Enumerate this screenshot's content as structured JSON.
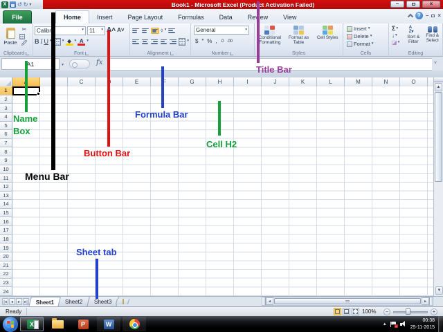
{
  "window": {
    "title": "Book1 - Microsoft Excel (Product Activation Failed)"
  },
  "quick_access": {
    "icons": [
      "excel-logo",
      "save",
      "undo",
      "redo",
      "customize-dropdown"
    ]
  },
  "tabs": {
    "file": "File",
    "active": "Home",
    "items": [
      "Home",
      "Insert",
      "Page Layout",
      "Formulas",
      "Data",
      "Review",
      "View"
    ]
  },
  "ribbon": {
    "clipboard": {
      "label": "Clipboard",
      "paste": "Paste"
    },
    "font": {
      "label": "Font",
      "name": "Calibri",
      "size": "11",
      "bold": "B",
      "italic": "I",
      "underline": "U"
    },
    "alignment": {
      "label": "Alignment"
    },
    "number": {
      "label": "Number",
      "format": "General",
      "currency": "$",
      "percent": "%",
      "comma": ",",
      "inc_decimal": ".0",
      "dec_decimal": ".00"
    },
    "styles": {
      "label": "Styles",
      "conditional": "Conditional Formatting",
      "format_table": "Format as Table",
      "cell_styles": "Cell Styles"
    },
    "cells": {
      "label": "Cells",
      "insert": "Insert",
      "delete": "Delete",
      "format": "Format"
    },
    "editing": {
      "label": "Editing",
      "autosum": "Σ",
      "sort_filter": "Sort & Filter",
      "find_select": "Find & Select"
    }
  },
  "formula_bar": {
    "name_box": "A1",
    "fx_label": "fx"
  },
  "grid": {
    "columns": [
      "A",
      "B",
      "C",
      "D",
      "E",
      "F",
      "G",
      "H",
      "I",
      "J",
      "K",
      "L",
      "M",
      "N",
      "O"
    ],
    "row_count": 24,
    "selected_cell": "A1",
    "selected_column": "A",
    "selected_row": 1
  },
  "sheet_tabs": {
    "active": "Sheet1",
    "items": [
      "Sheet1",
      "Sheet2",
      "Sheet3"
    ]
  },
  "status_bar": {
    "mode": "Ready",
    "zoom_level": "100%",
    "view_icons": [
      "normal-view",
      "page-layout-view",
      "page-break-view"
    ]
  },
  "taskbar": {
    "icons": [
      "windows-start",
      "excel",
      "file-explorer",
      "powerpoint",
      "word",
      "chrome"
    ],
    "tray_icons": [
      "hidden-icons",
      "action-center-flag",
      "volume"
    ],
    "clock": {
      "time": "00:38",
      "date": "25-11-2015"
    }
  },
  "annotations": [
    {
      "id": "title-bar",
      "label": "Title Bar",
      "color": "#993b99"
    },
    {
      "id": "menu-bar",
      "label": "Menu Bar",
      "color": "#000000"
    },
    {
      "id": "name-box",
      "label": "Name Box",
      "color": "#16a03a"
    },
    {
      "id": "button-bar",
      "label": "Button Bar",
      "color": "#e01212"
    },
    {
      "id": "formula-bar",
      "label": "Formula Bar",
      "color": "#2441c6"
    },
    {
      "id": "cell-h2",
      "label": "Cell H2",
      "color": "#16a03a"
    },
    {
      "id": "sheet-tab",
      "label": "Sheet tab",
      "color": "#2441c6"
    }
  ],
  "colors": {
    "title_bar": "#d40d0d",
    "file_tab": "#217346",
    "selected_header": "#f9c961"
  }
}
